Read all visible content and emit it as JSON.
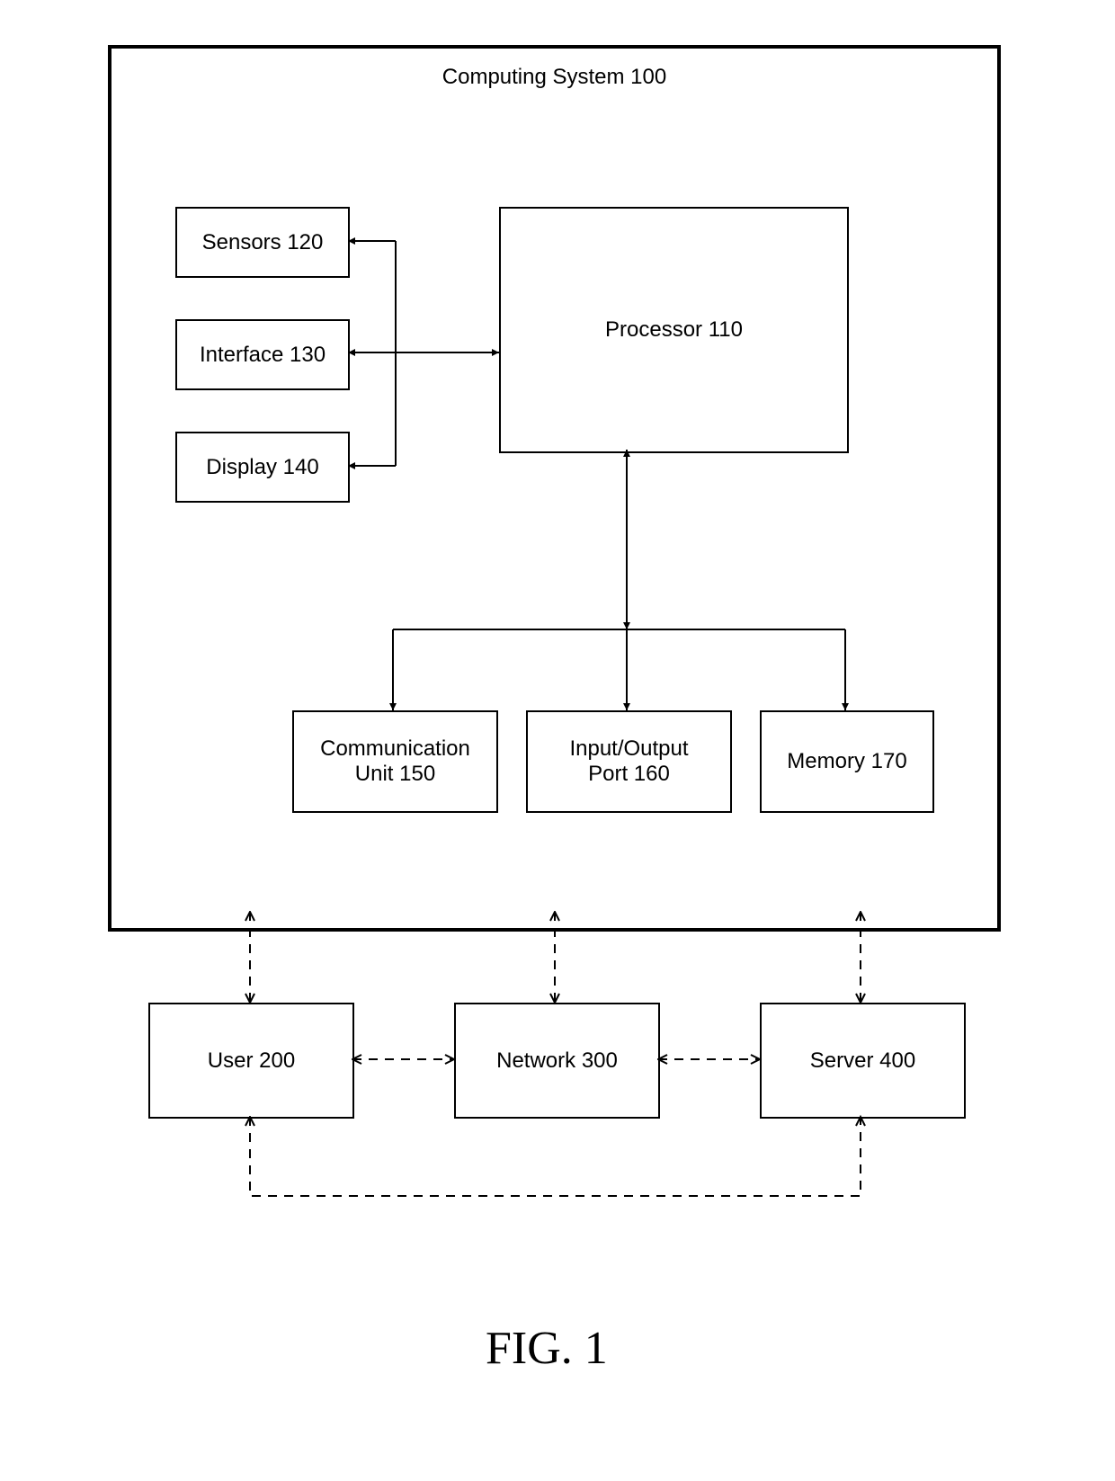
{
  "figure_label": "FIG. 1",
  "outer_box": {
    "label": "Computing System 100"
  },
  "blocks": {
    "sensors": {
      "label": "Sensors 120"
    },
    "interface": {
      "label": "Interface 130"
    },
    "display": {
      "label": "Display 140"
    },
    "processor": {
      "label": "Processor 110"
    },
    "comm_unit_l1": "Communication",
    "comm_unit_l2": "Unit 150",
    "io_port_l1": "Input/Output",
    "io_port_l2": "Port 160",
    "memory": {
      "label": "Memory 170"
    },
    "user": {
      "label": "User 200"
    },
    "network": {
      "label": "Network 300"
    },
    "server": {
      "label": "Server 400"
    }
  }
}
